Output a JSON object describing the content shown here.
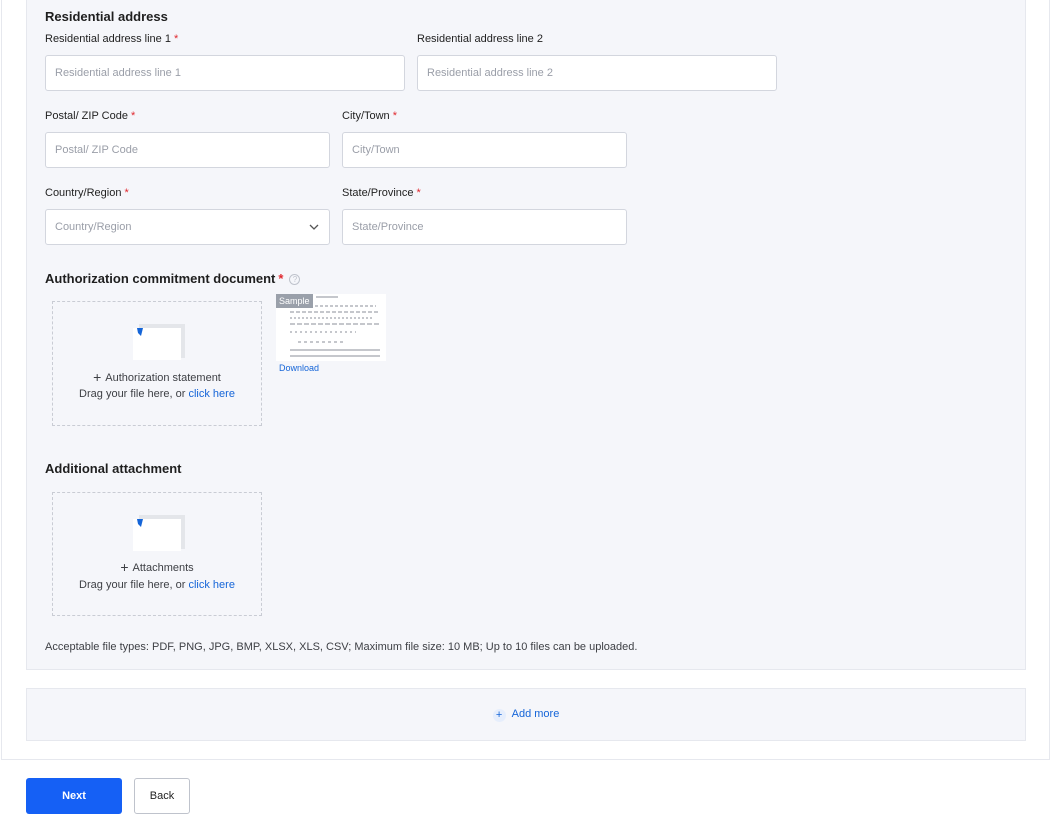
{
  "residential": {
    "section_title": "Residential address",
    "line1": {
      "label": "Residential address line 1",
      "required": "*",
      "placeholder": "Residential address line 1"
    },
    "line2": {
      "label": "Residential address line 2",
      "placeholder": "Residential address line 2"
    },
    "postal": {
      "label": "Postal/ ZIP Code",
      "required": "*",
      "placeholder": "Postal/ ZIP Code"
    },
    "city": {
      "label": "City/Town",
      "required": "*",
      "placeholder": "City/Town"
    },
    "country": {
      "label": "Country/Region",
      "required": "*",
      "placeholder": "Country/Region"
    },
    "state": {
      "label": "State/Province",
      "required": "*",
      "placeholder": "State/Province"
    }
  },
  "authorization": {
    "section_title": "Authorization commitment document",
    "required": "*",
    "help_glyph": "?",
    "dropzone": {
      "add_label": "Authorization statement",
      "drag_text": "Drag your file here, or ",
      "link_text": "click here"
    },
    "sample": {
      "tag": "Sample",
      "download_label": "Download"
    }
  },
  "additional": {
    "section_title": "Additional attachment",
    "dropzone": {
      "add_label": "Attachments",
      "drag_text": "Drag your file here, or ",
      "link_text": "click here"
    },
    "filetypes_note": "Acceptable file types: PDF, PNG, JPG, BMP, XLSX, XLS, CSV; Maximum file size: 10 MB; Up to 10 files can be uploaded."
  },
  "add_more": {
    "label": "Add more",
    "icon": "plus-circle-icon"
  },
  "footer": {
    "next_label": "Next",
    "back_label": "Back"
  },
  "colors": {
    "primary": "#1560f5",
    "link": "#1565d8",
    "required": "#e0282e",
    "panel_bg": "#f5f6fa"
  }
}
